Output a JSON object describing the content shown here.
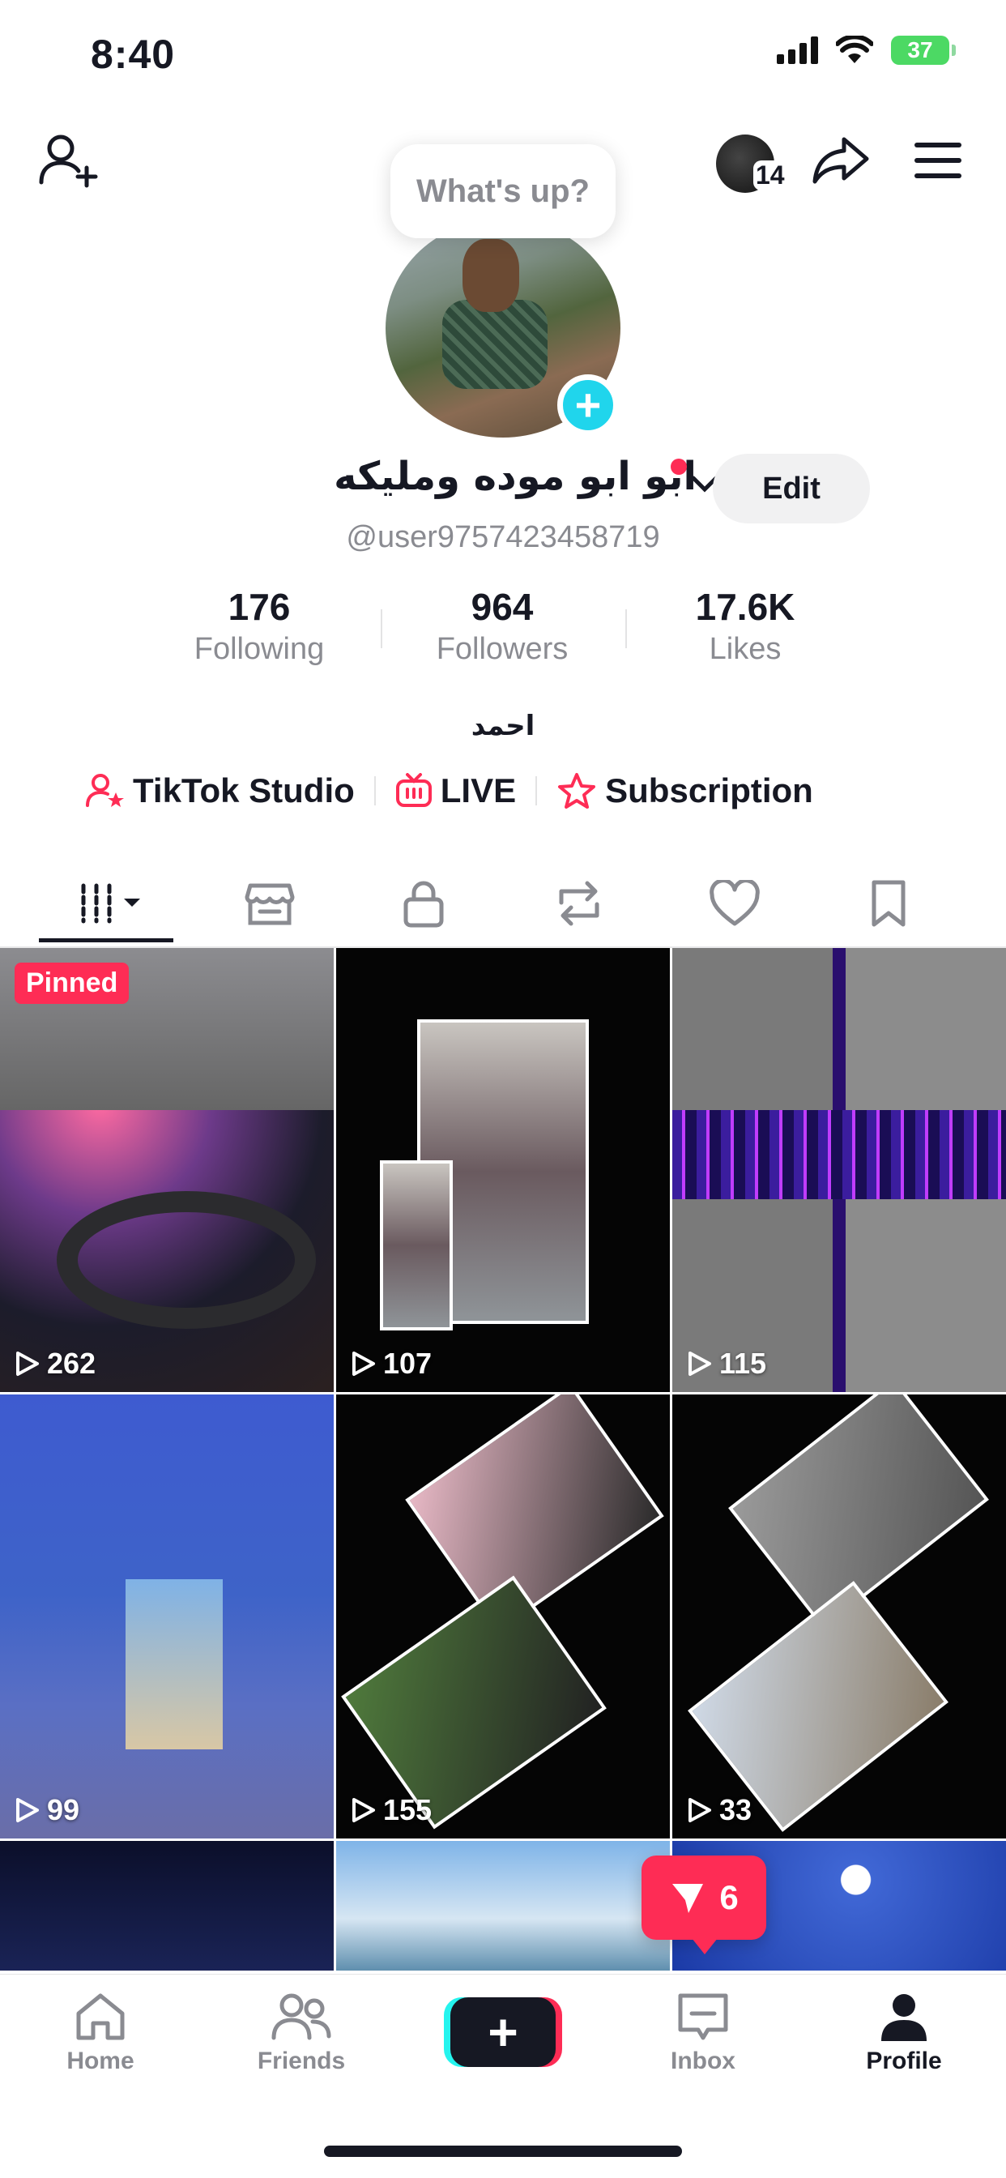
{
  "status_bar": {
    "time": "8:40",
    "battery": "37"
  },
  "header": {
    "avatar_notification_count": "14"
  },
  "profile": {
    "bubble_text": "What's up?",
    "display_name": "ابو ابو موده ومليكه",
    "edit_label": "Edit",
    "username": "@user9757423458719",
    "bio": "احمد"
  },
  "stats": [
    {
      "value": "176",
      "label": "Following"
    },
    {
      "value": "964",
      "label": "Followers"
    },
    {
      "value": "17.6K",
      "label": "Likes"
    }
  ],
  "links": [
    {
      "label": "TikTok Studio",
      "icon": "creator-icon"
    },
    {
      "label": "LIVE",
      "icon": "tv-icon"
    },
    {
      "label": "Subscription",
      "icon": "star-subscription-icon"
    }
  ],
  "tabs": [
    "videos-grid-icon",
    "shop-icon",
    "lock-icon",
    "repost-icon",
    "heart-icon",
    "bookmark-icon"
  ],
  "videos": [
    {
      "views": "262",
      "pinned_label": "Pinned"
    },
    {
      "views": "107"
    },
    {
      "views": "115"
    },
    {
      "views": "99"
    },
    {
      "views": "155"
    },
    {
      "views": "33"
    }
  ],
  "inbox_popup": {
    "count": "6"
  },
  "bottom_nav": [
    {
      "label": "Home",
      "icon": "home-icon"
    },
    {
      "label": "Friends",
      "icon": "friends-icon"
    },
    {
      "label": "",
      "icon": "plus-icon"
    },
    {
      "label": "Inbox",
      "icon": "inbox-icon"
    },
    {
      "label": "Profile",
      "icon": "profile-icon"
    }
  ],
  "colors": {
    "accent": "#fe2c55",
    "cyan": "#20d5ec",
    "text": "#161823",
    "muted": "#8a8b91"
  }
}
